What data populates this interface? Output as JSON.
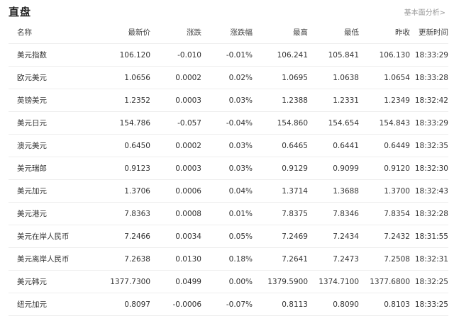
{
  "header": {
    "title": "直盘",
    "more_link": "基本面分析>"
  },
  "table": {
    "columns": [
      "名称",
      "最新价",
      "涨跌",
      "涨跌幅",
      "最高",
      "最低",
      "昨收",
      "更新时间"
    ],
    "rows": [
      {
        "name": "美元指数",
        "last": "106.120",
        "change": "-0.010",
        "pct": "-0.01%",
        "high": "106.241",
        "low": "105.841",
        "prev": "106.130",
        "time": "18:33:29",
        "dir": "down"
      },
      {
        "name": "欧元美元",
        "last": "1.0656",
        "change": "0.0002",
        "pct": "0.02%",
        "high": "1.0695",
        "low": "1.0638",
        "prev": "1.0654",
        "time": "18:33:28",
        "dir": "up"
      },
      {
        "name": "英镑美元",
        "last": "1.2352",
        "change": "0.0003",
        "pct": "0.03%",
        "high": "1.2388",
        "low": "1.2331",
        "prev": "1.2349",
        "time": "18:32:42",
        "dir": "up"
      },
      {
        "name": "美元日元",
        "last": "154.786",
        "change": "-0.057",
        "pct": "-0.04%",
        "high": "154.860",
        "low": "154.654",
        "prev": "154.843",
        "time": "18:33:29",
        "dir": "down"
      },
      {
        "name": "澳元美元",
        "last": "0.6450",
        "change": "0.0002",
        "pct": "0.03%",
        "high": "0.6465",
        "low": "0.6441",
        "prev": "0.6449",
        "time": "18:32:35",
        "dir": "up"
      },
      {
        "name": "美元瑞郎",
        "last": "0.9123",
        "change": "0.0003",
        "pct": "0.03%",
        "high": "0.9129",
        "low": "0.9099",
        "prev": "0.9120",
        "time": "18:32:30",
        "dir": "up"
      },
      {
        "name": "美元加元",
        "last": "1.3706",
        "change": "0.0006",
        "pct": "0.04%",
        "high": "1.3714",
        "low": "1.3688",
        "prev": "1.3700",
        "time": "18:32:43",
        "dir": "up"
      },
      {
        "name": "美元港元",
        "last": "7.8363",
        "change": "0.0008",
        "pct": "0.01%",
        "high": "7.8375",
        "low": "7.8346",
        "prev": "7.8354",
        "time": "18:32:28",
        "dir": "up"
      },
      {
        "name": "美元在岸人民币",
        "last": "7.2466",
        "change": "0.0034",
        "pct": "0.05%",
        "high": "7.2469",
        "low": "7.2434",
        "prev": "7.2432",
        "time": "18:31:55",
        "dir": "up"
      },
      {
        "name": "美元离岸人民币",
        "last": "7.2638",
        "change": "0.0130",
        "pct": "0.18%",
        "high": "7.2641",
        "low": "7.2473",
        "prev": "7.2508",
        "time": "18:32:31",
        "dir": "up"
      },
      {
        "name": "美元韩元",
        "last": "1377.7300",
        "change": "0.0499",
        "pct": "0.00%",
        "high": "1379.5900",
        "low": "1374.7100",
        "prev": "1377.6800",
        "time": "18:32:25",
        "dir": "up"
      },
      {
        "name": "纽元加元",
        "last": "0.8097",
        "change": "-0.0006",
        "pct": "-0.07%",
        "high": "0.8113",
        "low": "0.8090",
        "prev": "0.8103",
        "time": "18:33:25",
        "dir": "down"
      }
    ]
  },
  "colors": {
    "up": "#e5484d",
    "down": "#2ea043",
    "divider": "#eeeeee",
    "muted": "#999999"
  }
}
